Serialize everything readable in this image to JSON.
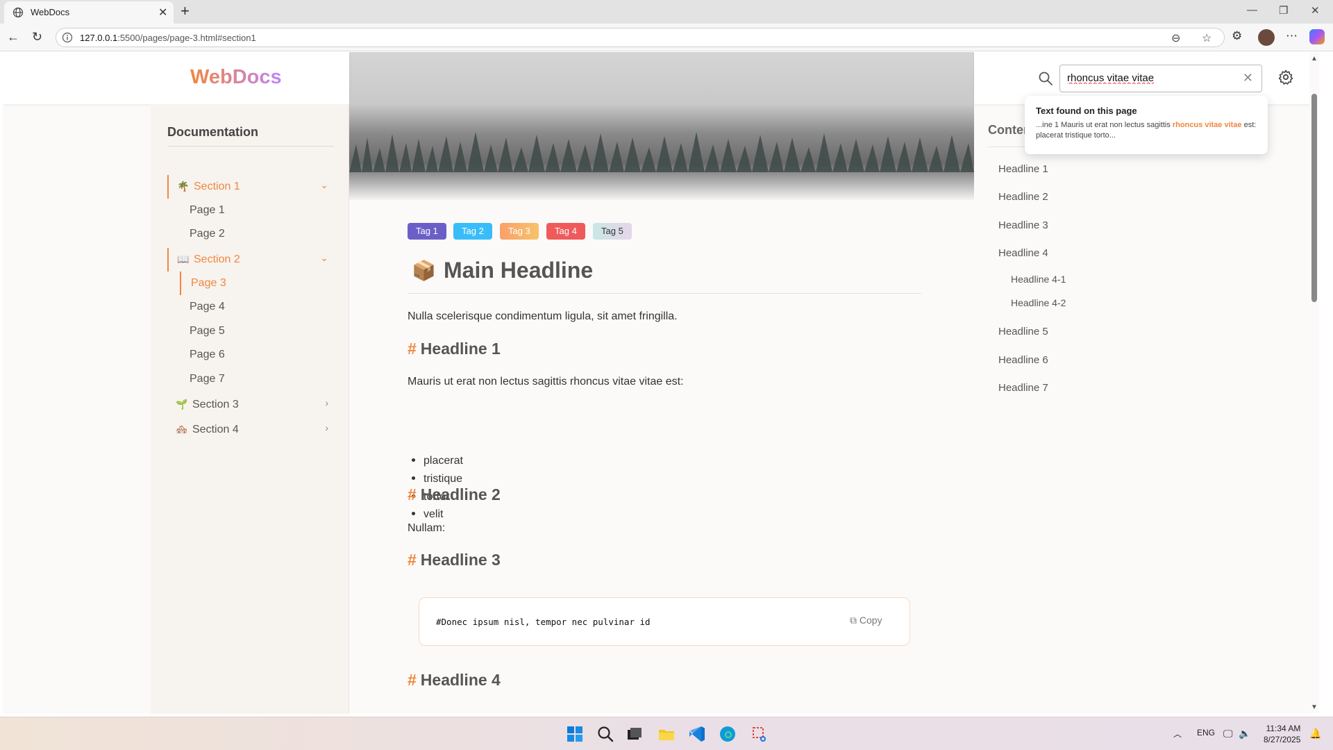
{
  "browser": {
    "tab_title": "WebDocs",
    "url_prefix": "127.0.0.1",
    "url_rest": ":5500/pages/page-3.html#section1"
  },
  "site": {
    "logo": "WebDocs",
    "search_value": "rhoncus vitae vitae"
  },
  "popup": {
    "title": "Text found on this page",
    "before": "...ine 1 Mauris ut erat non lectus sagittis ",
    "highlight": "rhoncus vitae vitae",
    "after": " est: placerat tristique torto..."
  },
  "sidebar": {
    "title": "Documentation",
    "sections": [
      {
        "emoji": "🌴",
        "label": "Section 1",
        "state": "expanded"
      },
      {
        "emoji": "📖",
        "label": "Section 2",
        "state": "expanded"
      },
      {
        "emoji": "🌱",
        "label": "Section 3",
        "state": "collapsed"
      },
      {
        "emoji": "🏘️",
        "label": "Section 4",
        "state": "collapsed"
      }
    ],
    "pages": [
      "Page 1",
      "Page 2",
      "Page 3",
      "Page 4",
      "Page 5",
      "Page 6",
      "Page 7"
    ],
    "active_page": "Page 3"
  },
  "tags": [
    {
      "label": "Tag 1",
      "color": "#6b5fc7"
    },
    {
      "label": "Tag 2",
      "color": "#38bdf8"
    },
    {
      "label": "Tag 3",
      "color": "#f9a06a"
    },
    {
      "label": "Tag 4",
      "color": "#ef5b5b"
    },
    {
      "label": "Tag 5",
      "color": "#c9e7e6"
    }
  ],
  "content": {
    "main_headline": "Main Headline",
    "intro": "Nulla scelerisque condimentum ligula, sit amet fringilla.",
    "h1": "Headline 1",
    "p1": "Mauris ut erat non lectus sagittis rhoncus vitae vitae est:",
    "list": [
      "placerat",
      "tristique",
      "tortor",
      "velit"
    ],
    "h2": "Headline 2",
    "p2": "Nullam:",
    "h3": "Headline 3",
    "code": "#Donec ipsum nisl, tempor nec pulvinar id",
    "copy_label": "Copy",
    "h4": "Headline 4"
  },
  "toc": {
    "title": "Content",
    "items": [
      "Headline 1",
      "Headline 2",
      "Headline 3",
      "Headline 4",
      "Headline 4-1",
      "Headline 4-2",
      "Headline 5",
      "Headline 6",
      "Headline 7"
    ]
  },
  "taskbar": {
    "lang": "ENG",
    "time": "11:34 AM",
    "date": "8/27/2025"
  },
  "colors": {
    "accent": "#f0873e"
  }
}
